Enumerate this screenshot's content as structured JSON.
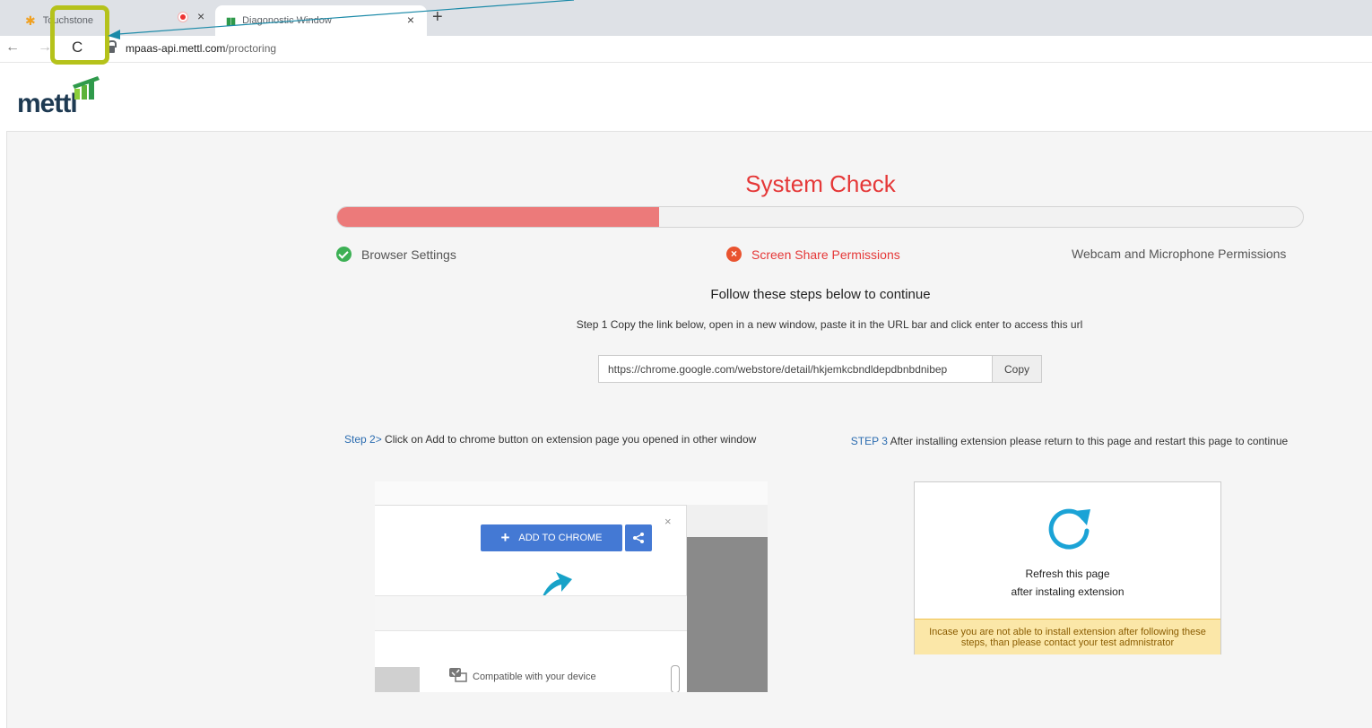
{
  "browser": {
    "tabs": [
      {
        "title": "Touchstone",
        "active": false
      },
      {
        "title": "Diagonostic Window",
        "active": true
      }
    ],
    "tab_close_glyph": "×",
    "new_tab_glyph": "+",
    "nav": {
      "back": "←",
      "forward": "→",
      "reload": "C"
    },
    "url_host": "mpaas-api.mettl.com",
    "url_path": "/proctoring"
  },
  "logo": {
    "text": "mettl"
  },
  "system_check": {
    "title": "System Check",
    "progress_fraction": 0.333,
    "steps": [
      {
        "label": "Browser Settings",
        "status": "done"
      },
      {
        "label": "Screen Share Permissions",
        "status": "error"
      },
      {
        "label": "Webcam and Microphone Permissions",
        "status": "pending"
      }
    ],
    "follow_text": "Follow these steps below to continue",
    "step1_text": "Step 1 Copy the link below, open in a new window, paste it in the URL bar and click enter to access this url",
    "link_value": "https://chrome.google.com/webstore/detail/hkjemkcbndldepdbnbdnibep",
    "copy_label": "Copy",
    "step2_prefix": "Step 2>",
    "step2_text": " Click on Add to chrome button on extension page you opened in other window",
    "step3_prefix": "STEP 3",
    "step3_text": " After installing extension please return to this page and restart this page to continue"
  },
  "illustration": {
    "close_glyph": "×",
    "add_button": "ADD TO CHROME",
    "compat_text": "Compatible with your device"
  },
  "refresh_card": {
    "line1": "Refresh this page",
    "line2": "after instaling extension",
    "warning": "Incase you are not able to install extension after following these steps, than please contact your test admnistrator"
  },
  "colors": {
    "accent_red": "#e53838",
    "progress_fill": "#ec7a7a",
    "highlight": "#b5c21b",
    "add_button_blue": "#4479d4",
    "refresh_blue": "#1ba3d6"
  }
}
